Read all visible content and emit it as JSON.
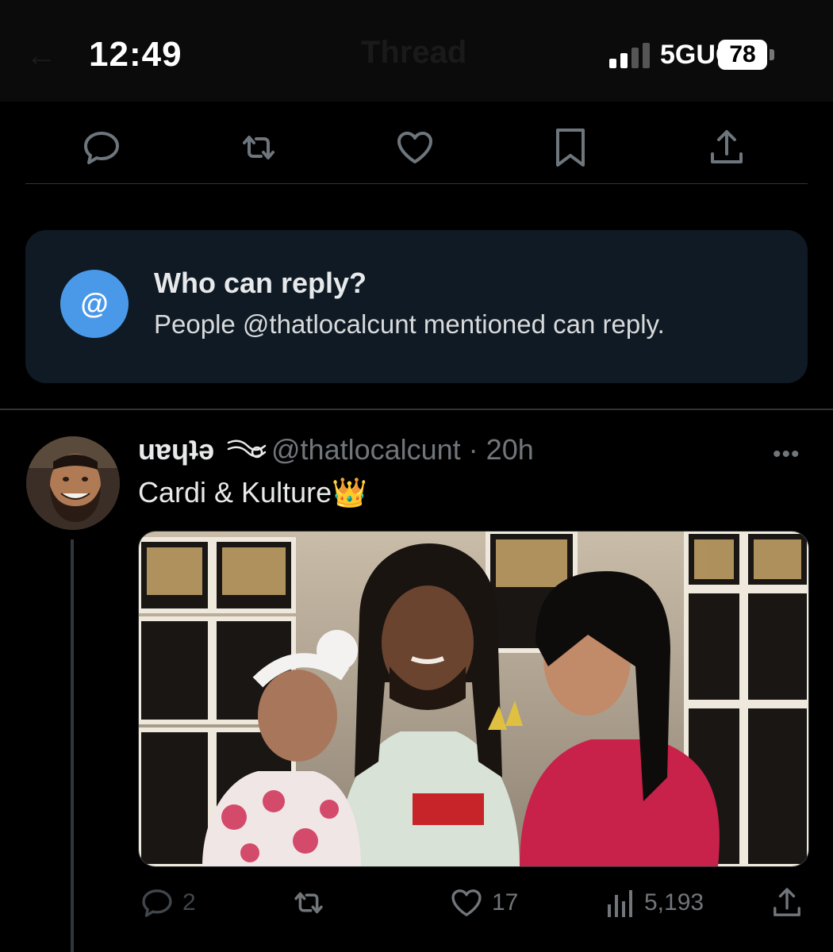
{
  "status_bar": {
    "time": "12:49",
    "network": "5GUC",
    "battery": "78"
  },
  "nav": {
    "title": "Thread"
  },
  "main_tweet_actions": [
    "reply-icon",
    "retweet-icon",
    "like-icon",
    "bookmark-icon",
    "share-icon"
  ],
  "reply_restriction": {
    "icon": "@",
    "title": "Who can reply?",
    "subtitle": "People @thatlocalcunt mentioned can reply."
  },
  "reply_tweet": {
    "display_name": "uɐɥʇǝ",
    "handle_time": "@thatlocalcunt · 20h",
    "text": "Cardi & Kulture",
    "emoji": "👑",
    "more": "•••",
    "metrics": {
      "replies": "2",
      "likes": "17",
      "views": "5,193"
    }
  },
  "colors": {
    "background": "#000000",
    "card": "#0f1a24",
    "accent": "#4a99e9",
    "muted": "#71767b"
  }
}
